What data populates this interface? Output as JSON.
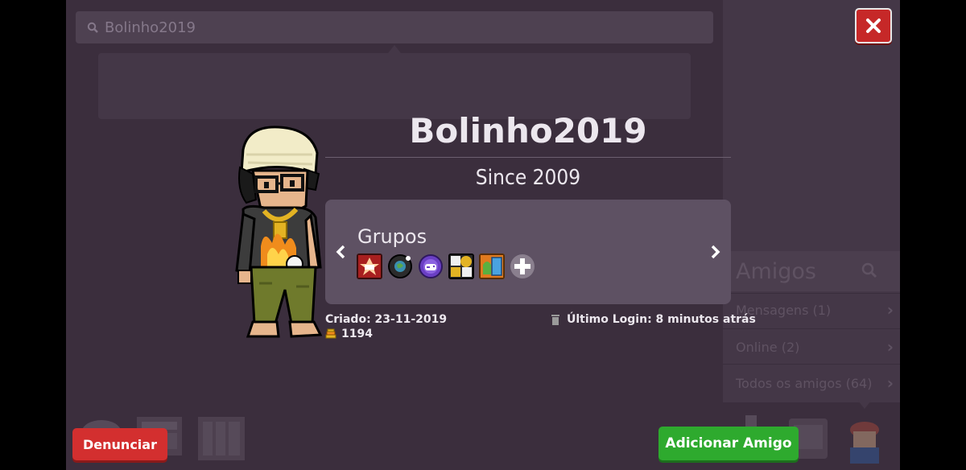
{
  "search": {
    "value": "Bolinho2019"
  },
  "profile": {
    "name": "Bolinho2019",
    "since": "Since 2009",
    "groups_title": "Grupos",
    "created_label": "Criado: 23-11-2019",
    "last_login_label": "Último Login: 8 minutos atrás",
    "score": "1194"
  },
  "friends": {
    "title": "Amigos",
    "items": [
      {
        "label": "Mensagens (1)"
      },
      {
        "label": "Online (2)"
      },
      {
        "label": "Todos os amigos (64)"
      }
    ]
  },
  "buttons": {
    "report": "Denunciar",
    "add_friend": "Adicionar Amigo",
    "close": "✕"
  },
  "groups_badges": [
    {
      "icon": "red-group-badge-icon",
      "color": "#c62828"
    },
    {
      "icon": "globe-group-badge-icon",
      "color": "#2b2b2b"
    },
    {
      "icon": "purple-gamepad-badge-icon",
      "color": "#6a3fc4"
    },
    {
      "icon": "gold-clock-badge-icon",
      "color": "#d4a017"
    },
    {
      "icon": "orange-blue-badge-icon",
      "color": "#e07a1f"
    },
    {
      "icon": "add-group-icon",
      "color": "#8a7f8e"
    }
  ],
  "colors": {
    "background": "#3b2e3d",
    "report_button": "#d32f2f",
    "add_button": "#2eaa2e",
    "close_button": "#c62828"
  }
}
